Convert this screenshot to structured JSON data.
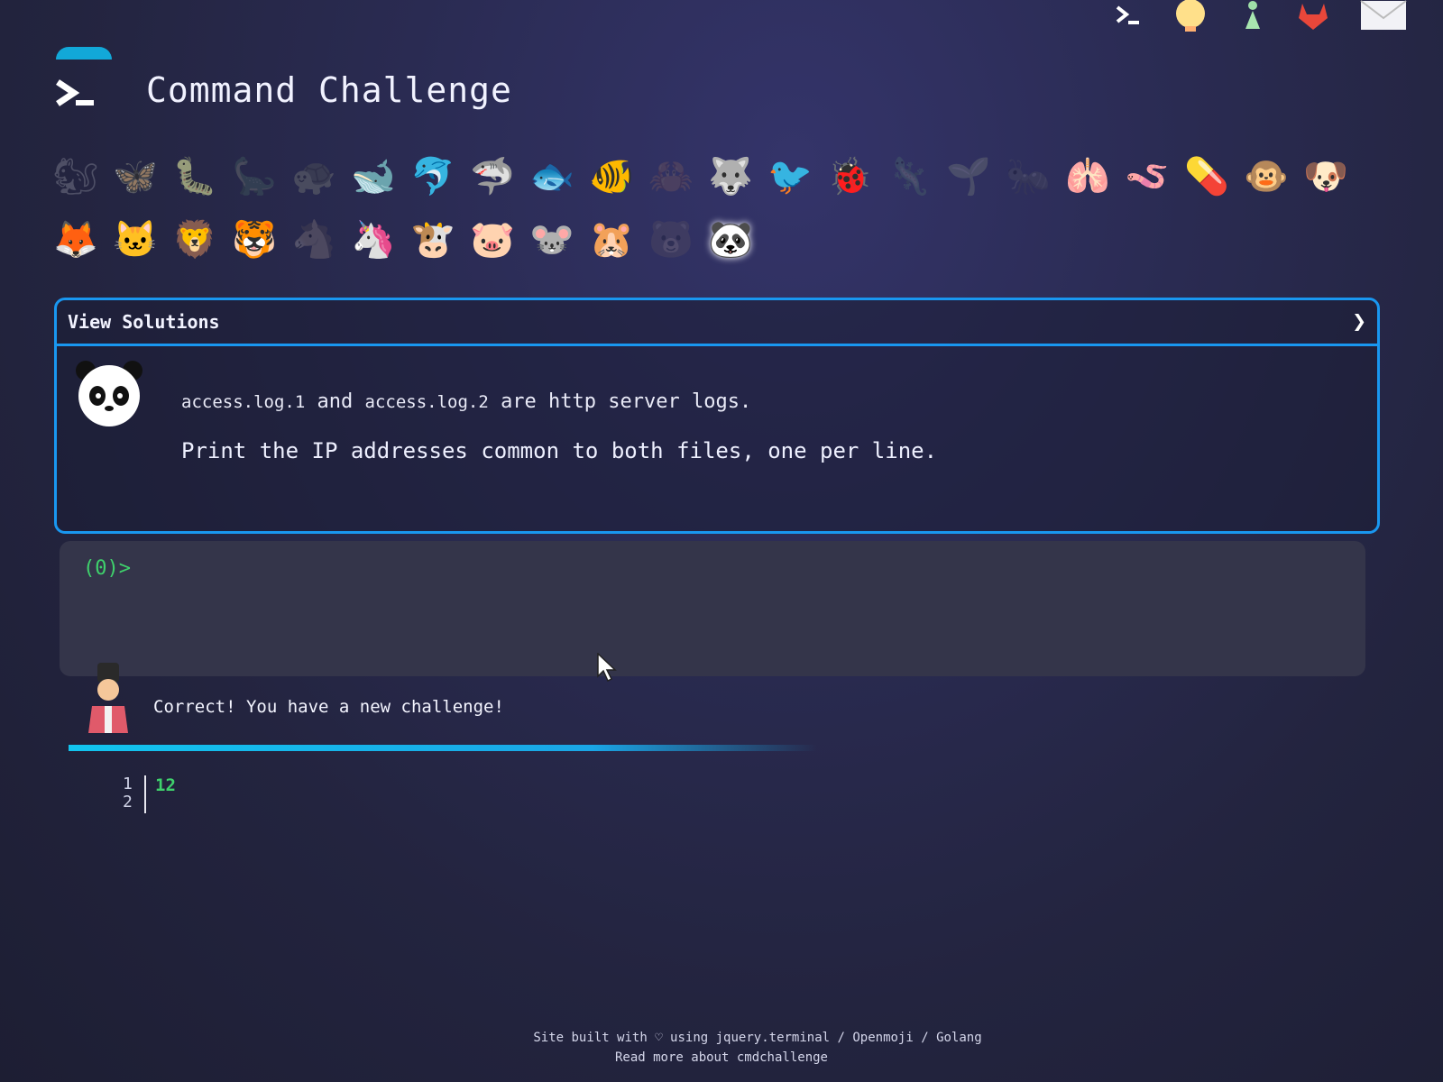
{
  "header": {
    "title": "Command Challenge",
    "top_icons": [
      "terminal-icon",
      "lightbulb-icon",
      "person-icon",
      "gitlab-icon",
      "mail-icon"
    ]
  },
  "animals": {
    "row1": [
      "chipmunk",
      "butterfly",
      "caterpillar",
      "dinosaur",
      "turtle",
      "whale",
      "dolphin",
      "shark",
      "fish",
      "tropical-fish",
      "crab",
      "wolf",
      "bird",
      "beetle",
      "lizard",
      "plant",
      "ant",
      "lungs",
      "worm",
      "blue-pill",
      "monkey",
      "dog"
    ],
    "row2": [
      "fox",
      "cat",
      "lion",
      "tiger",
      "horse-head",
      "unicorn",
      "cow",
      "pig",
      "mouse",
      "hamster",
      "bear",
      "panda"
    ],
    "selected": "panda"
  },
  "panel": {
    "header_label": "View Solutions",
    "file1": "access.log.1",
    "and_word": "and",
    "file2": "access.log.2",
    "tail": "are http server logs.",
    "instruction": "Print the IP addresses common to both files, one per line."
  },
  "terminal": {
    "prompt": "(0)>"
  },
  "feedback": {
    "message": "Correct! You have a new challenge!"
  },
  "output": {
    "line_numbers": [
      "1",
      "2"
    ],
    "value": "12"
  },
  "footer": {
    "line1": "Site built with ♡ using jquery.terminal / Openmoji / Golang",
    "line2": "Read more about cmdchallenge"
  },
  "colors": {
    "accent": "#1997f0",
    "prompt_green": "#3fd16c"
  }
}
